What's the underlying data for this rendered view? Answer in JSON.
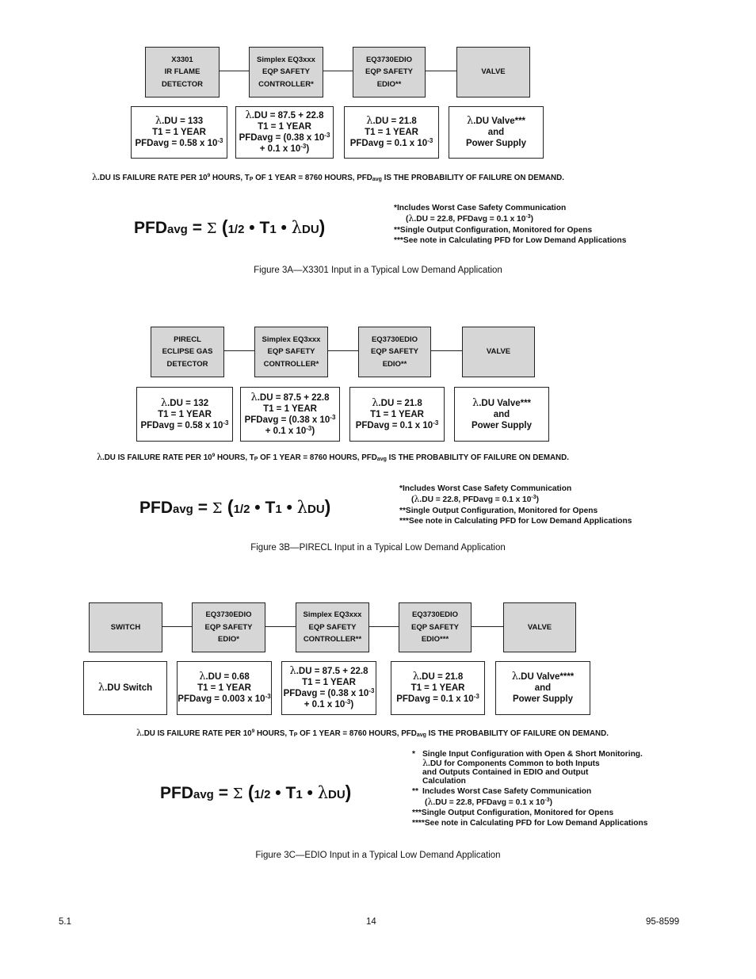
{
  "figures": [
    {
      "blocks": [
        {
          "lines": [
            "X3301",
            "IR FLAME",
            "DETECTOR"
          ]
        },
        {
          "lines": [
            "Simplex EQ3xxx",
            "EQP SAFETY",
            "CONTROLLER*"
          ]
        },
        {
          "lines": [
            "EQ3730EDIO",
            "EQP SAFETY",
            "EDIO**"
          ]
        },
        {
          "lines": [
            "VALVE"
          ]
        }
      ],
      "values": [
        {
          "l1": ".DU = 133",
          "l2": "T1 = 1 YEAR",
          "l3": "PFDavg = 0.58 x 10",
          "l3_exp": "-3"
        },
        {
          "l1": ".DU = 87.5 + 22.8",
          "l2": "T1 = 1 YEAR",
          "l3": "PFDavg = (0.38 x 10",
          "l3_exp": "-3",
          "l4": "+ 0.1 x 10",
          "l4_exp": "-3",
          "l4_end": ")"
        },
        {
          "l1": ".DU = 21.8",
          "l2": "T1 = 1 YEAR",
          "l3": "PFDavg = 0.1 x 10",
          "l3_exp": "-3"
        },
        {
          "l1": ".DU Valve***",
          "l2": "and",
          "l3": "Power Supply"
        }
      ],
      "note": {
        "a": ".DU IS FAILURE RATE PER 10",
        "exp": "9",
        "b": " HOURS, T",
        "sub": "P",
        "c": " OF 1 YEAR = 8760 HOURS, PFD",
        "sub2": "avg",
        "d": " IS THE PROBABILITY OF FAILURE ON DEMAND."
      },
      "formula": {
        "pfd": "PFD",
        "avg": "avg",
        "eq": " = ",
        "sigma": "Σ",
        "open": " (",
        "half": "1/2",
        "dot1": " • ",
        "t": "T",
        "t_sub": "1",
        "dot2": " • ",
        "du": "DU",
        "close": ")"
      },
      "footnotes": [
        "*Includes Worst Case Safety Communication",
        "(",
        ".DU = 22.8, PFDavg = 0.1 x 10",
        "-3",
        ")",
        "**Single Output Configuration, Monitored for Opens",
        "***See note in Calculating PFD for Low Demand Applications"
      ],
      "caption": "Figure 3A—X3301 Input in a Typical Low Demand Application"
    },
    {
      "blocks": [
        {
          "lines": [
            "PIRECL",
            "ECLIPSE GAS",
            "DETECTOR"
          ]
        },
        {
          "lines": [
            "Simplex EQ3xxx",
            "EQP SAFETY",
            "CONTROLLER*"
          ]
        },
        {
          "lines": [
            "EQ3730EDIO",
            "EQP SAFETY",
            "EDIO**"
          ]
        },
        {
          "lines": [
            "VALVE"
          ]
        }
      ],
      "values": [
        {
          "l1": ".DU = 132",
          "l2": "T1 = 1 YEAR",
          "l3": "PFDavg = 0.58 x 10",
          "l3_exp": "-3"
        },
        {
          "l1": ".DU = 87.5 + 22.8",
          "l2": "T1 = 1 YEAR",
          "l3": "PFDavg = (0.38 x 10",
          "l3_exp": "-3",
          "l4": "+ 0.1 x 10",
          "l4_exp": "-3",
          "l4_end": ")"
        },
        {
          "l1": ".DU = 21.8",
          "l2": "T1 = 1 YEAR",
          "l3": "PFDavg = 0.1 x 10",
          "l3_exp": "-3"
        },
        {
          "l1": ".DU Valve***",
          "l2": "and",
          "l3": "Power Supply"
        }
      ],
      "note": {
        "a": ".DU IS FAILURE RATE PER 10",
        "exp": "9",
        "b": " HOURS, T",
        "sub": "P",
        "c": " OF 1 YEAR = 8760 HOURS, PFD",
        "sub2": "avg",
        "d": " IS THE PROBABILITY OF FAILURE ON DEMAND."
      },
      "formula": {
        "pfd": "PFD",
        "avg": "avg",
        "eq": " = ",
        "sigma": "Σ",
        "open": " (",
        "half": "1/2",
        "dot1": " • ",
        "t": "T",
        "t_sub": "1",
        "dot2": " • ",
        "du": "DU",
        "close": ")"
      },
      "footnotes": [
        "*Includes Worst Case Safety Communication",
        "(",
        ".DU = 22.8, PFDavg = 0.1 x 10",
        "-3",
        ")",
        "**Single Output Configuration, Monitored for Opens",
        "***See note in Calculating PFD for Low Demand Applications"
      ],
      "caption": "Figure 3B—PIRECL Input in a Typical Low Demand Application"
    },
    {
      "blocks": [
        {
          "lines": [
            "SWITCH"
          ]
        },
        {
          "lines": [
            "EQ3730EDIO",
            "EQP SAFETY",
            "EDIO*"
          ]
        },
        {
          "lines": [
            "Simplex EQ3xxx",
            "EQP SAFETY",
            "CONTROLLER**"
          ]
        },
        {
          "lines": [
            "EQ3730EDIO",
            "EQP SAFETY",
            "EDIO***"
          ]
        },
        {
          "lines": [
            "VALVE"
          ]
        }
      ],
      "values": [
        {
          "l1": ".DU Switch"
        },
        {
          "l1": ".DU = 0.68",
          "l2": "T1 = 1 YEAR",
          "l3": "PFDavg = 0.003 x 10",
          "l3_exp": "-3"
        },
        {
          "l1": ".DU = 87.5 + 22.8",
          "l2": "T1 = 1 YEAR",
          "l3": "PFDavg = (0.38 x 10",
          "l3_exp": "-3",
          "l4": "+ 0.1 x 10",
          "l4_exp": "-3",
          "l4_end": ")"
        },
        {
          "l1": ".DU = 21.8",
          "l2": "T1 = 1 YEAR",
          "l3": "PFDavg = 0.1 x 10",
          "l3_exp": "-3"
        },
        {
          "l1": ".DU Valve****",
          "l2": "and",
          "l3": "Power Supply"
        }
      ],
      "note": {
        "a": ".DU IS FAILURE RATE PER 10",
        "exp": "9",
        "b": " HOURS, T",
        "sub": "P",
        "c": " OF 1 YEAR = 8760 HOURS, PFD",
        "sub2": "avg",
        "d": " IS THE PROBABILITY OF FAILURE ON DEMAND."
      },
      "formula": {
        "pfd": "PFD",
        "avg": "avg",
        "eq": " = ",
        "sigma": "Σ",
        "open": " (",
        "half": "1/2",
        "dot1": " • ",
        "t": "T",
        "t_sub": "1",
        "dot2": " • ",
        "du": "DU",
        "close": ")"
      },
      "footnotes_c": {
        "f1_mark": "*",
        "f1_a": "Single Input Configuration with Open & Short Monitoring.",
        "f1_b": ".DU for Components Common to both Inputs",
        "f1_c": "and Outputs Contained in EDIO and Output",
        "f1_d": "Calculation",
        "f2_mark": "**",
        "f2_a": "Includes Worst Case Safety Communication",
        "f2_b": ".DU = 22.8, PFDavg = 0.1 x 10",
        "f2_exp": "-3",
        "f3": "***Single Output Configuration, Monitored for Opens",
        "f4": "****See note in Calculating PFD for Low Demand Applications"
      },
      "caption": "Figure 3C—EDIO Input in a Typical Low Demand Application"
    }
  ],
  "symbols": {
    "lambda": "λ"
  },
  "footer": {
    "left": "5.1",
    "center": "14",
    "right": "95-8599"
  }
}
